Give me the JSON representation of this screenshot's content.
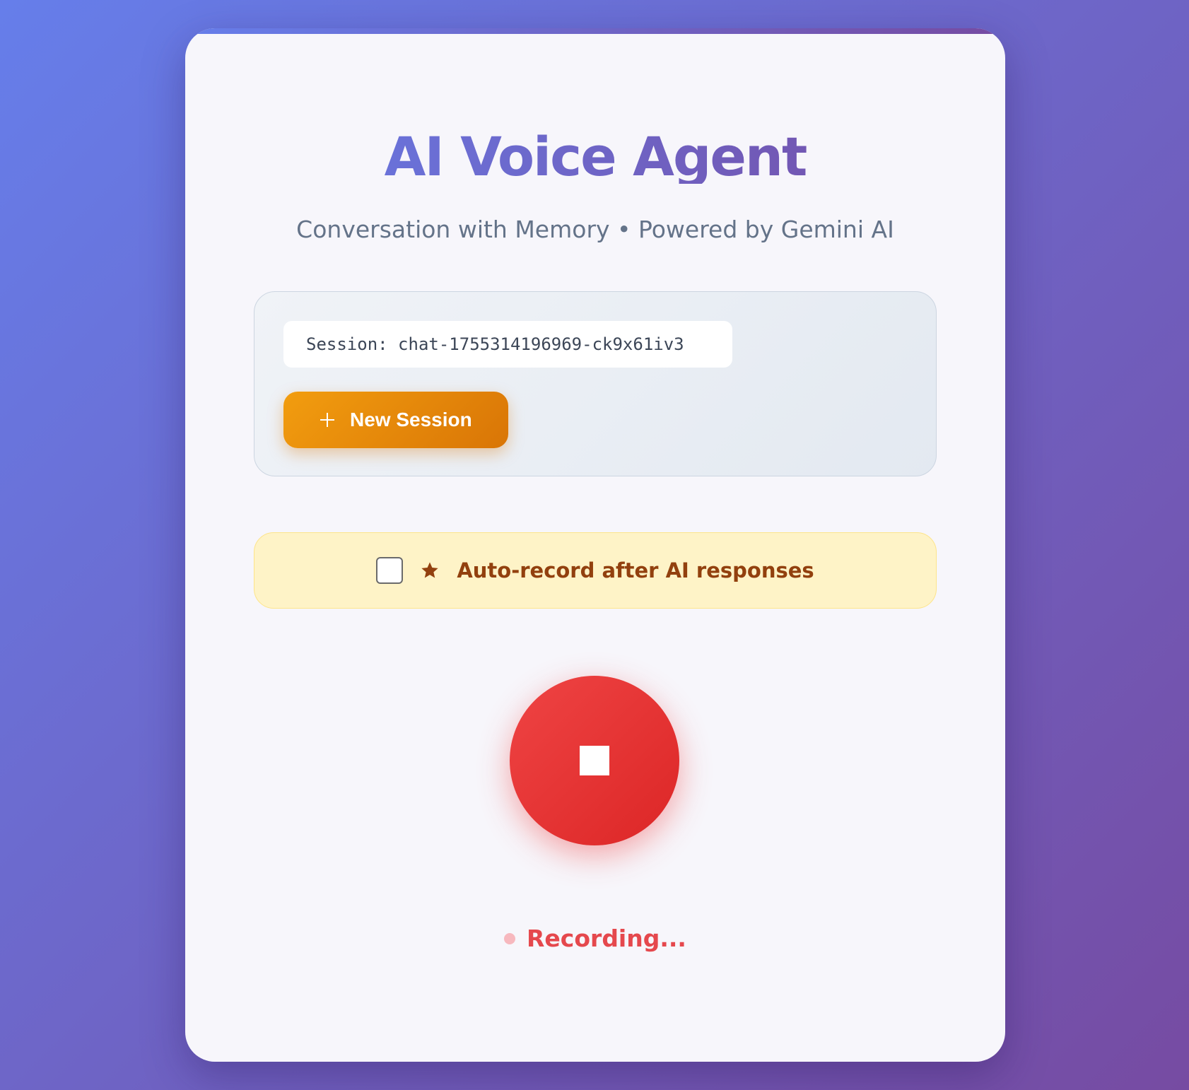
{
  "app": {
    "title": "AI Voice Agent",
    "subtitle": "Conversation with Memory • Powered by Gemini AI"
  },
  "session": {
    "id_label": "Session: chat-1755314196969-ck9x61iv3",
    "new_session_label": "New Session"
  },
  "auto_record": {
    "checked": false,
    "icon": "star-icon",
    "label": "Auto-record after AI responses"
  },
  "recorder": {
    "state": "recording",
    "button_icon": "stop-icon",
    "status_text": "Recording..."
  },
  "colors": {
    "background_gradient": [
      "#667eea",
      "#764ba2"
    ],
    "accent_orange": "#f29d0f",
    "record_red": "#ef4444",
    "autorecord_bg": "#fef3c7",
    "autorecord_text": "#92400e"
  }
}
